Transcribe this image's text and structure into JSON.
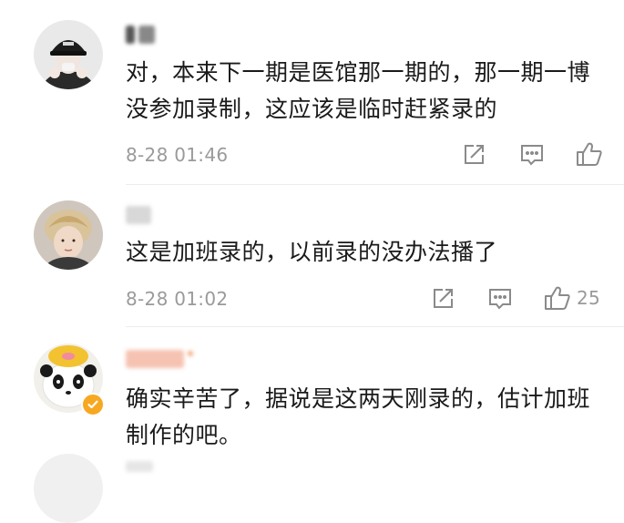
{
  "comments": [
    {
      "text": "对，本来下一期是医馆那一期的，那一期一博没参加录制，这应该是临时赶紧录的",
      "time": "8-28 01:46",
      "likes": ""
    },
    {
      "text": "这是加班录的，以前录的没办法播了",
      "time": "8-28 01:02",
      "likes": "25"
    },
    {
      "text": "确实辛苦了，据说是这两天刚录的，估计加班制作的吧。",
      "time": "",
      "likes": ""
    }
  ],
  "icons": {
    "share": "share-icon",
    "reply": "comment-icon",
    "like": "thumbs-up-icon",
    "verified": "verified-badge-icon"
  },
  "colors": {
    "text": "#1a1a1a",
    "meta": "#9a9a9a",
    "verified_badge": "#f7a821",
    "divider": "#ececec"
  }
}
